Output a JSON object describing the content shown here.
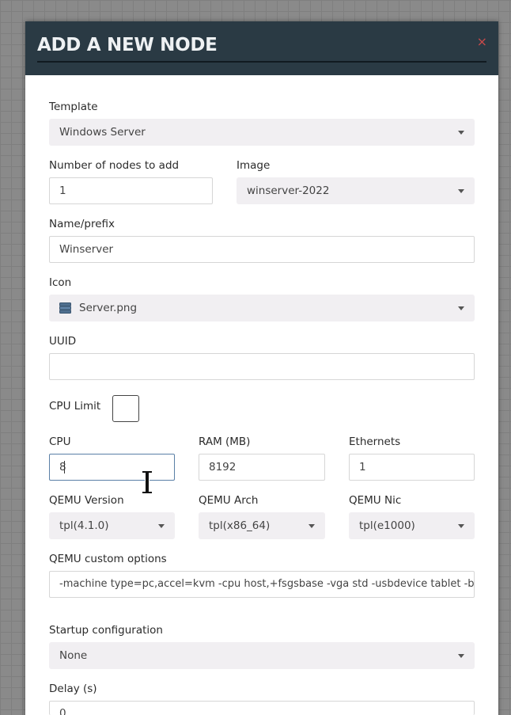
{
  "modal": {
    "title": "ADD A NEW NODE",
    "close_glyph": "×"
  },
  "fields": {
    "template": {
      "label": "Template",
      "value": "Windows Server"
    },
    "num_nodes": {
      "label": "Number of nodes to add",
      "value": "1"
    },
    "image": {
      "label": "Image",
      "value": "winserver-2022"
    },
    "name_prefix": {
      "label": "Name/prefix",
      "value": "Winserver"
    },
    "icon": {
      "label": "Icon",
      "value": "Server.png",
      "icon_name": "server-icon"
    },
    "uuid": {
      "label": "UUID",
      "value": ""
    },
    "cpu_limit": {
      "label": "CPU Limit",
      "checked": false
    },
    "cpu": {
      "label": "CPU",
      "value": "8"
    },
    "ram": {
      "label": "RAM (MB)",
      "value": "8192"
    },
    "ethernets": {
      "label": "Ethernets",
      "value": "1"
    },
    "qemu_version": {
      "label": "QEMU Version",
      "value": "tpl(4.1.0)"
    },
    "qemu_arch": {
      "label": "QEMU Arch",
      "value": "tpl(x86_64)"
    },
    "qemu_nic": {
      "label": "QEMU Nic",
      "value": "tpl(e1000)"
    },
    "qemu_custom": {
      "label": "QEMU custom options",
      "value": "-machine type=pc,accel=kvm -cpu host,+fsgsbase -vga std -usbdevice tablet -boot order=cd"
    },
    "startup_config": {
      "label": "Startup configuration",
      "value": "None"
    },
    "delay": {
      "label": "Delay (s)",
      "value": "0"
    }
  },
  "colors": {
    "header_bg": "#2a3a44",
    "close_icon": "#c94a4a",
    "select_bg": "#f1eff2",
    "focus_border": "#5a7fa6"
  }
}
